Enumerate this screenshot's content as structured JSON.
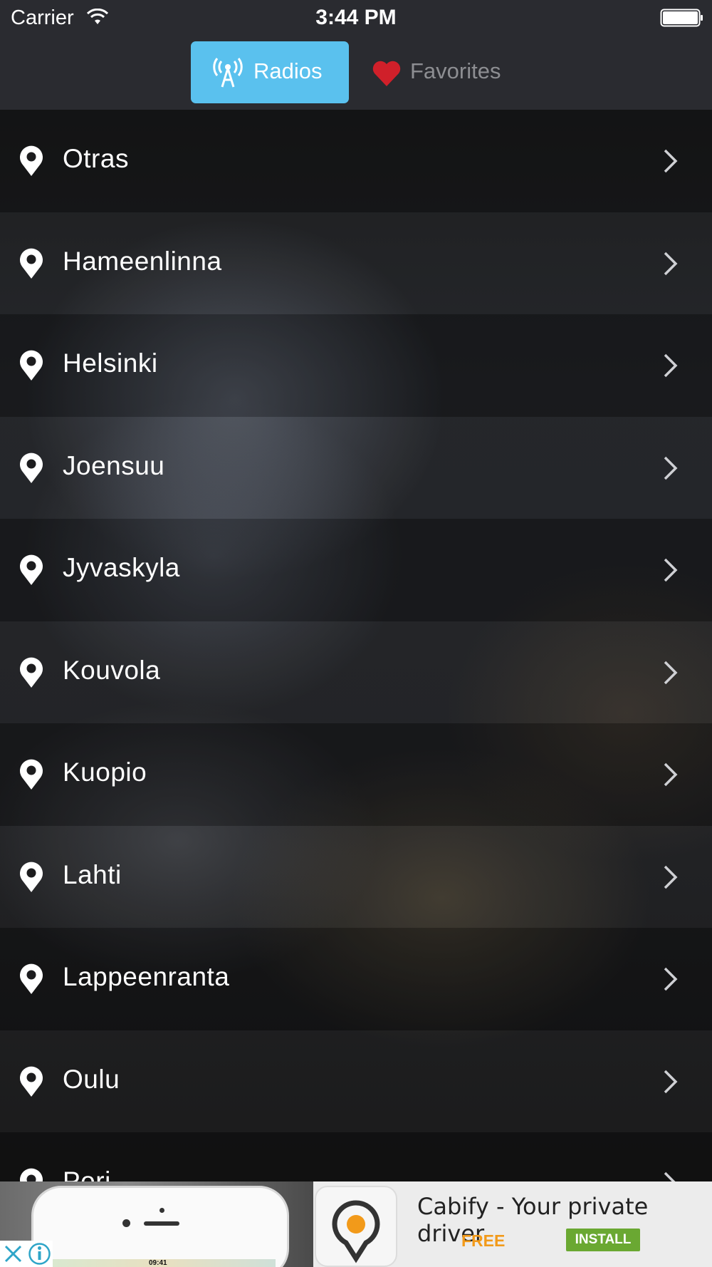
{
  "status_bar": {
    "carrier": "Carrier",
    "time": "3:44 PM",
    "icons": [
      "wifi-icon",
      "battery-icon"
    ]
  },
  "tabs": [
    {
      "label": "Radios",
      "icon": "antenna-icon",
      "selected": true,
      "color": "#5ac1ee"
    },
    {
      "label": "Favorites",
      "icon": "heart-icon",
      "selected": false,
      "color": "#d0202a"
    }
  ],
  "list": {
    "icon": "pin-icon",
    "trailing_icon": "chevron-right-icon",
    "items": [
      {
        "label": "Otras"
      },
      {
        "label": "Hameenlinna"
      },
      {
        "label": "Helsinki"
      },
      {
        "label": "Joensuu"
      },
      {
        "label": "Jyvaskyla"
      },
      {
        "label": "Kouvola"
      },
      {
        "label": "Kuopio"
      },
      {
        "label": "Lahti"
      },
      {
        "label": "Lappeenranta"
      },
      {
        "label": "Oulu"
      },
      {
        "label": "Pori"
      }
    ]
  },
  "ad": {
    "title": "Cabify - Your private driver",
    "price": "FREE",
    "install_label": "INSTALL",
    "phone_screen_time": "09:41",
    "accent_color": "#6aa832"
  }
}
